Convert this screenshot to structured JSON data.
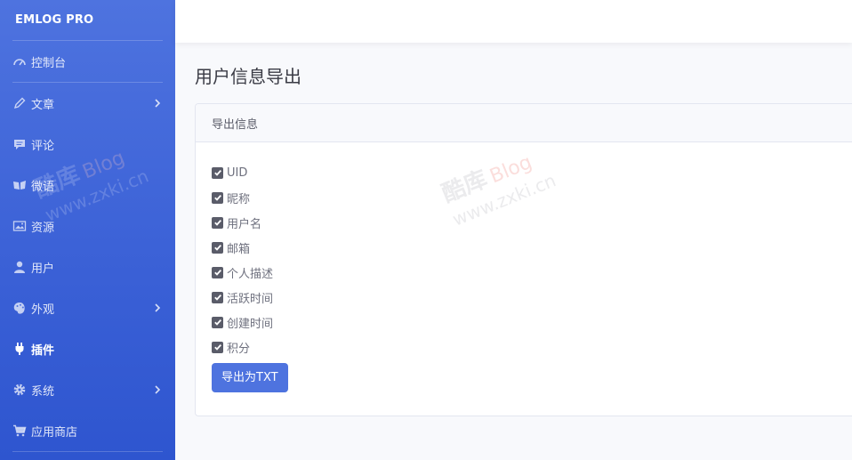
{
  "brand": {
    "name": "EMLOG PRO"
  },
  "sidebar": {
    "items": [
      {
        "label": "控制台",
        "icon": "dashboard-icon",
        "arrow": false,
        "active": false
      },
      {
        "label": "文章",
        "icon": "pencil-icon",
        "arrow": true,
        "active": false
      },
      {
        "label": "评论",
        "icon": "comment-icon",
        "arrow": false,
        "active": false
      },
      {
        "label": "微语",
        "icon": "book-icon",
        "arrow": false,
        "active": false
      },
      {
        "label": "资源",
        "icon": "image-icon",
        "arrow": false,
        "active": false
      },
      {
        "label": "用户",
        "icon": "user-icon",
        "arrow": false,
        "active": false
      },
      {
        "label": "外观",
        "icon": "palette-icon",
        "arrow": true,
        "active": false
      },
      {
        "label": "插件",
        "icon": "plug-icon",
        "arrow": false,
        "active": true
      },
      {
        "label": "系统",
        "icon": "gear-icon",
        "arrow": true,
        "active": false
      },
      {
        "label": "应用商店",
        "icon": "cart-icon",
        "arrow": false,
        "active": false
      }
    ]
  },
  "page": {
    "title": "用户信息导出"
  },
  "card": {
    "header": "导出信息"
  },
  "fields": [
    {
      "label": "UID",
      "checked": true
    },
    {
      "label": "昵称",
      "checked": true
    },
    {
      "label": "用户名",
      "checked": true
    },
    {
      "label": "邮箱",
      "checked": true
    },
    {
      "label": "个人描述",
      "checked": true
    },
    {
      "label": "活跃时间",
      "checked": true
    },
    {
      "label": "创建时间",
      "checked": true
    },
    {
      "label": "积分",
      "checked": true
    }
  ],
  "actions": {
    "export_label": "导出为TXT"
  },
  "watermark": {
    "cn": "酷库",
    "brand": "Blog",
    "url": "www.zxki.cn"
  },
  "colors": {
    "sidebar": "#4e73df",
    "primary": "#4e73df",
    "page_bg": "#f8f9fc"
  }
}
